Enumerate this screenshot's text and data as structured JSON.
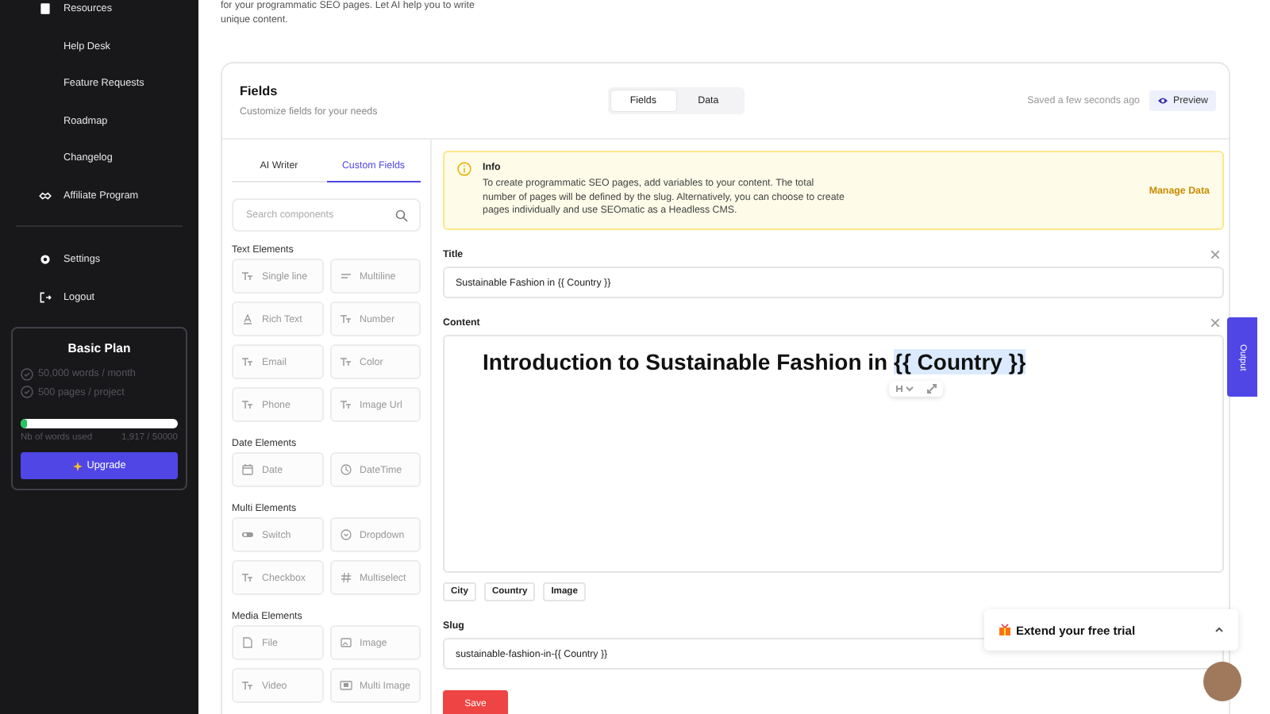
{
  "sidebar": {
    "nav_items": [
      {
        "label": "Resources",
        "kind": "book"
      },
      {
        "label": "Help Desk",
        "kind": "plain"
      },
      {
        "label": "Feature Requests",
        "kind": "plain"
      },
      {
        "label": "Roadmap",
        "kind": "plain"
      },
      {
        "label": "Changelog",
        "kind": "plain"
      },
      {
        "label": "Affiliate Program",
        "kind": "handshake"
      }
    ],
    "account_items": [
      {
        "label": "Settings",
        "kind": "gear"
      },
      {
        "label": "Logout",
        "kind": "logout"
      }
    ],
    "plan": {
      "title": "Basic Plan",
      "features": [
        "50,000 words / month",
        "500 pages / project"
      ],
      "usage_label": "Nb of words used",
      "usage_reading": "1,917 / 50000",
      "level": 0.04,
      "upgrade_button": "Upgrade"
    }
  },
  "intro_text": "for your programmatic SEO pages. Let AI help you to write unique content.",
  "fields_card": {
    "title": "Fields",
    "subtitle": "Customize fields for your needs",
    "view_tabs": [
      {
        "label": "Fields",
        "selected": true
      },
      {
        "label": "Data",
        "selected": false
      }
    ],
    "save_status": "Saved a few seconds ago",
    "preview_button": "Preview",
    "left_panel": {
      "tabs": [
        {
          "label": "AI Writer",
          "selected": false
        },
        {
          "label": "Custom Fields",
          "selected": true
        }
      ],
      "search": {
        "placeholder": "Search components"
      },
      "groups": [
        {
          "title": "Text Elements",
          "elements": [
            {
              "label": "Single line",
              "kind": "text"
            },
            {
              "label": "Multiline",
              "kind": "lines"
            },
            {
              "label": "Rich Text",
              "kind": "richtext"
            },
            {
              "label": "Number",
              "kind": "text"
            },
            {
              "label": "Email",
              "kind": "text"
            },
            {
              "label": "Color",
              "kind": "text"
            },
            {
              "label": "Phone",
              "kind": "text"
            },
            {
              "label": "Image Url",
              "kind": "text"
            }
          ]
        },
        {
          "title": "Date Elements",
          "elements": [
            {
              "label": "Date",
              "kind": "calendar"
            },
            {
              "label": "DateTime",
              "kind": "clock"
            }
          ]
        },
        {
          "title": "Multi Elements",
          "elements": [
            {
              "label": "Switch",
              "kind": "toggle"
            },
            {
              "label": "Dropdown",
              "kind": "dropdown"
            },
            {
              "label": "Checkbox",
              "kind": "text"
            },
            {
              "label": "Multiselect",
              "kind": "hash"
            }
          ]
        },
        {
          "title": "Media Elements",
          "elements": [
            {
              "label": "File",
              "kind": "file"
            },
            {
              "label": "Image",
              "kind": "image"
            },
            {
              "label": "Video",
              "kind": "text"
            },
            {
              "label": "Multi Image",
              "kind": "multiimage"
            }
          ]
        }
      ]
    },
    "info": {
      "title": "Info",
      "text": "To create programmatic SEO pages, add variables to your content. The total number of pages will be defined by the slug. Alternatively, you can choose to create pages individually and use SEOmatic as a Headless CMS.",
      "action": "Manage Data"
    },
    "fields": [
      {
        "kind": "input",
        "label": "Title",
        "value": "Sustainable Fashion in {{ Country }}"
      },
      {
        "kind": "editor",
        "label": "Content",
        "heading": "Introduction to Sustainable Fashion in",
        "heading_variable": "{{ Country }}",
        "variables": [
          "City",
          "Country",
          "Image"
        ]
      },
      {
        "kind": "input",
        "label": "Slug",
        "value": "sustainable-fashion-in-{{ Country }}"
      }
    ],
    "save_button": "Save"
  },
  "output_tab": "Output",
  "trial_popup": {
    "text": "Extend your free trial",
    "expanded": false
  }
}
